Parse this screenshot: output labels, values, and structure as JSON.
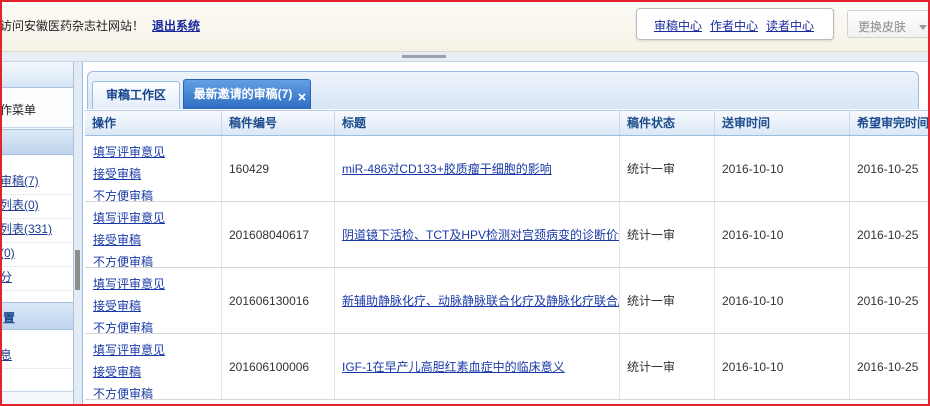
{
  "top_bar": {
    "welcome_text": "访问安徽医药杂志社网站！",
    "logout_label": "退出系统",
    "center_links": [
      "审稿中心",
      "作者中心",
      "读者中心"
    ],
    "skin_select": {
      "label": "更换皮肤",
      "icon": "chevron-down-icon"
    }
  },
  "sidebar": {
    "menu_header": "作菜单",
    "menu_items": [
      "审稿(7)",
      "列表(0)",
      "列表(331)",
      "(0)",
      "分"
    ],
    "settings_header": "置",
    "settings_items": [
      "息"
    ]
  },
  "tabs": [
    {
      "label": "审稿工作区",
      "active": false
    },
    {
      "label": "最新邀请的审稿(7)",
      "active": true,
      "icon": "close-icon"
    }
  ],
  "table": {
    "columns": [
      "操作",
      "稿件编号",
      "标题",
      "稿件状态",
      "送审时间",
      "希望审完时间"
    ],
    "rows": [
      {
        "actions": [
          "填写评审意见",
          "接受审稿",
          "不方便审稿"
        ],
        "manuscript_id": "160429",
        "title": "miR-486对CD133+胶质瘤干细胞的影响",
        "status": "统计一审",
        "sent_date": "2016-10-10",
        "due_date": "2016-10-25"
      },
      {
        "actions": [
          "填写评审意见",
          "接受审稿",
          "不方便审稿"
        ],
        "manuscript_id": "201608040617",
        "title": "阴道镜下活检、TCT及HPV检测对宫颈病变的诊断价值",
        "status": "统计一审",
        "sent_date": "2016-10-10",
        "due_date": "2016-10-25"
      },
      {
        "actions": [
          "填写评审意见",
          "接受审稿",
          "不方便审稿"
        ],
        "manuscript_id": "201606130016",
        "title": "新辅助静脉化疗、动脉静脉联合化疗及静脉化疗联合腔",
        "status": "统计一审",
        "sent_date": "2016-10-10",
        "due_date": "2016-10-25"
      },
      {
        "actions": [
          "填写评审意见",
          "接受审稿",
          "不方便审稿"
        ],
        "manuscript_id": "201606100006",
        "title": "IGF-1在早产儿高胆红素血症中的临床意义",
        "status": "统计一审",
        "sent_date": "2016-10-10",
        "due_date": "2016-10-25"
      }
    ]
  },
  "colors": {
    "link": "#1a3aa8",
    "header_text": "#1d4c8c",
    "tab_active": "#3a7bd0",
    "annotation_border": "#e3222b"
  }
}
